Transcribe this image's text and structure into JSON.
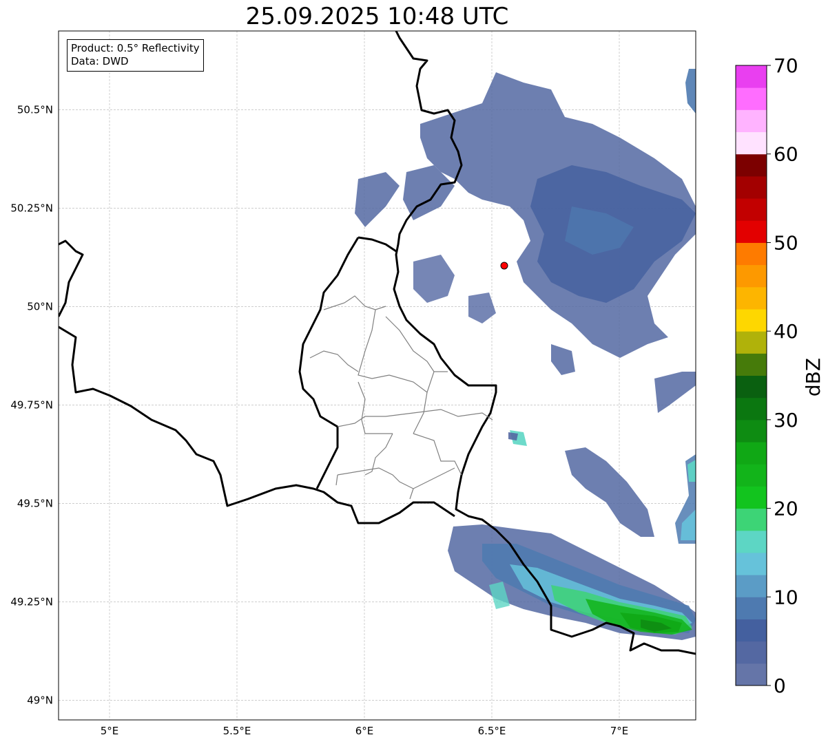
{
  "title": "25.09.2025 10:48 UTC",
  "info": {
    "product": "Product: 0.5° Reflectivity",
    "data": "Data: DWD"
  },
  "map": {
    "lon_range": [
      4.8,
      7.3
    ],
    "lat_range": [
      48.95,
      50.7
    ],
    "lon_ticks": [
      {
        "value": 5.0,
        "label": "5°E"
      },
      {
        "value": 5.5,
        "label": "5.5°E"
      },
      {
        "value": 6.0,
        "label": "6°E"
      },
      {
        "value": 6.5,
        "label": "6.5°E"
      },
      {
        "value": 7.0,
        "label": "7°E"
      }
    ],
    "lat_ticks": [
      {
        "value": 49.0,
        "label": "49°N"
      },
      {
        "value": 49.25,
        "label": "49.25°N"
      },
      {
        "value": 49.5,
        "label": "49.5°N"
      },
      {
        "value": 49.75,
        "label": "49.75°N"
      },
      {
        "value": 50.0,
        "label": "50°N"
      },
      {
        "value": 50.25,
        "label": "50.25°N"
      },
      {
        "value": 50.5,
        "label": "50.5°N"
      }
    ],
    "grid": true,
    "radar_site": {
      "lon": 6.55,
      "lat": 50.11,
      "color": "#ff0000"
    }
  },
  "colorbar": {
    "label": "dBZ",
    "min": 0,
    "max": 70,
    "step": 2.5,
    "ticks": [
      {
        "value": 0,
        "label": "0"
      },
      {
        "value": 10,
        "label": "10"
      },
      {
        "value": 20,
        "label": "20"
      },
      {
        "value": 30,
        "label": "30"
      },
      {
        "value": 40,
        "label": "40"
      },
      {
        "value": 50,
        "label": "50"
      },
      {
        "value": 60,
        "label": "60"
      },
      {
        "value": 70,
        "label": "70"
      }
    ],
    "colors": [
      "#6575a8",
      "#5468a2",
      "#44609f",
      "#4e7ab0",
      "#5b9cc6",
      "#66c2da",
      "#5dd6c4",
      "#3dd476",
      "#12c41e",
      "#12b41a",
      "#10a815",
      "#0e8c12",
      "#0b7710",
      "#0a6010",
      "#467b0a",
      "#b0b20a",
      "#fed700",
      "#fdb500",
      "#fd9900",
      "#fe7b00",
      "#e30000",
      "#c20000",
      "#a30000",
      "#7c0000",
      "#ffe2ff",
      "#ffb3ff",
      "#ff6dff",
      "#e93ff0"
    ]
  },
  "chart_data": {
    "type": "heatmap",
    "title": "25.09.2025 10:48 UTC",
    "variable": "dBZ",
    "value_range": [
      0,
      70
    ],
    "echo_regions": [
      {
        "region": "north-east of radar site",
        "lon_range": [
          6.2,
          7.3
        ],
        "lat_range": [
          49.85,
          50.62
        ],
        "dbz_approx": [
          2,
          12
        ]
      },
      {
        "region": "south-east band",
        "lon_range": [
          6.35,
          7.3
        ],
        "lat_range": [
          49.15,
          49.45
        ],
        "dbz_approx": [
          5,
          30
        ]
      },
      {
        "region": "east of 7°E",
        "lon_range": [
          6.75,
          7.3
        ],
        "lat_range": [
          49.4,
          49.75
        ],
        "dbz_approx": [
          2,
          17
        ]
      }
    ]
  }
}
